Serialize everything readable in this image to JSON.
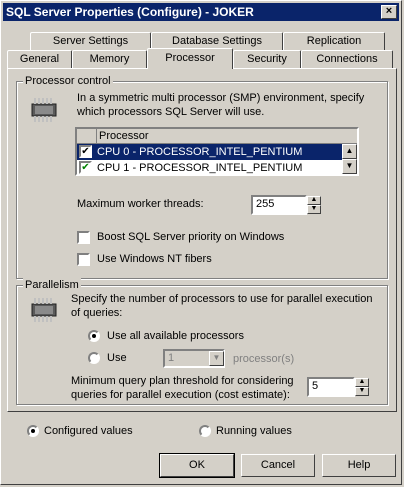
{
  "window": {
    "title": "SQL Server Properties (Configure)  - JOKER",
    "close_glyph": "×"
  },
  "tabs_row1": [
    {
      "label": "Server Settings"
    },
    {
      "label": "Database Settings"
    },
    {
      "label": "Replication"
    }
  ],
  "tabs_row2": [
    {
      "label": "General"
    },
    {
      "label": "Memory"
    },
    {
      "label": "Processor"
    },
    {
      "label": "Security"
    },
    {
      "label": "Connections"
    }
  ],
  "active_tab": "Processor",
  "processor_control": {
    "title": "Processor control",
    "description": "In a symmetric multi processor (SMP) environment, specify which processors SQL Server will use.",
    "list_header": "Processor",
    "processors": [
      {
        "label": "CPU 0 - PROCESSOR_INTEL_PENTIUM",
        "checked": true,
        "selected": true
      },
      {
        "label": "CPU 1 - PROCESSOR_INTEL_PENTIUM",
        "checked": true,
        "selected": false
      }
    ],
    "max_worker_label": "Maximum worker threads:",
    "max_worker_value": "255",
    "boost_label": "Boost SQL Server priority on Windows",
    "fibers_label": "Use Windows NT fibers"
  },
  "parallelism": {
    "title": "Parallelism",
    "description": "Specify the number of processors to use for parallel execution of queries:",
    "use_all_label": "Use all available processors",
    "use_label": "Use",
    "use_value": "1",
    "processors_suffix": "processor(s)",
    "threshold_label": "Minimum query plan threshold for considering queries for parallel execution (cost estimate):",
    "threshold_value": "5"
  },
  "values_mode": {
    "configured_label": "Configured values",
    "running_label": "Running values"
  },
  "buttons": {
    "ok": "OK",
    "cancel": "Cancel",
    "help": "Help"
  }
}
